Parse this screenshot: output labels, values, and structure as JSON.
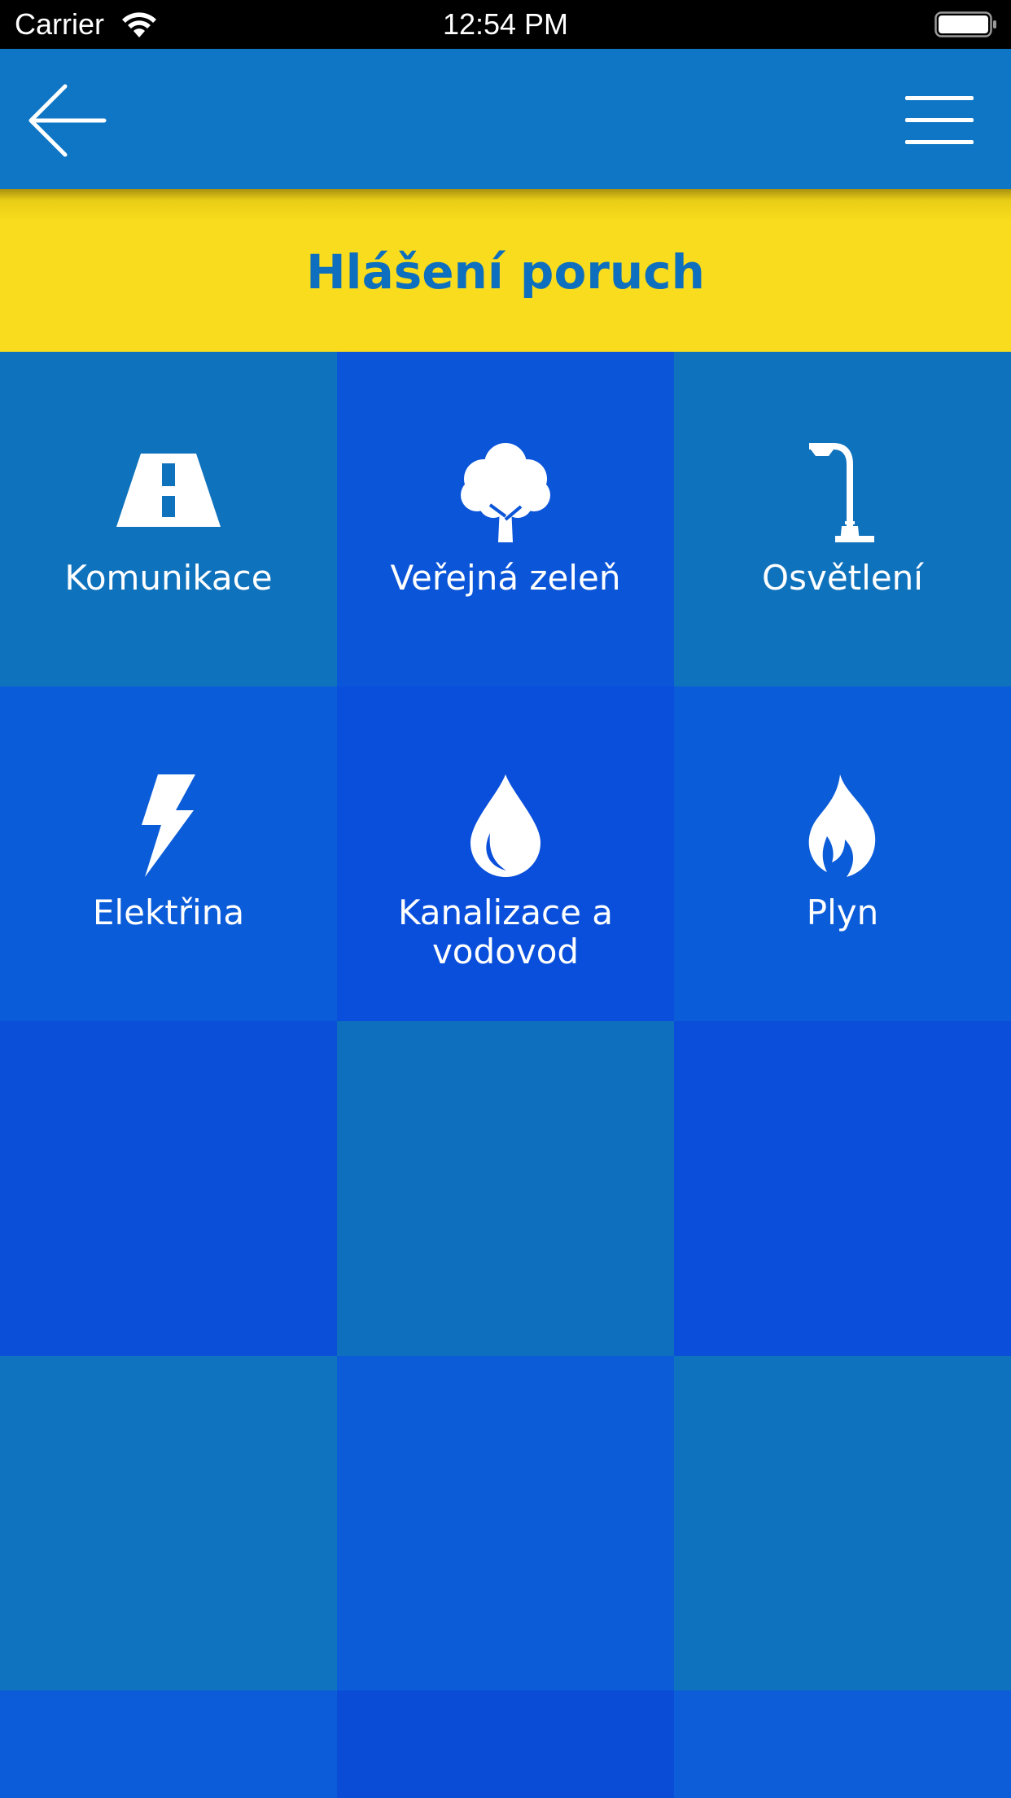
{
  "status_bar": {
    "carrier": "Carrier",
    "time": "12:54 PM"
  },
  "header": {
    "title": "Hlášení poruch"
  },
  "categories": [
    {
      "label": "Komunikace",
      "icon": "road-icon"
    },
    {
      "label": "Veřejná zeleň",
      "icon": "tree-icon"
    },
    {
      "label": "Osvětlení",
      "icon": "street-lamp-icon"
    },
    {
      "label": "Elektřina",
      "icon": "lightning-bolt-icon"
    },
    {
      "label_line1": "Kanalizace a",
      "label_line2": "vodovod",
      "icon": "water-drop-icon"
    },
    {
      "label": "Plyn",
      "icon": "flame-icon"
    }
  ],
  "colors": {
    "nav_bar": "#0e76c4",
    "title_banner": "#f8dc1d",
    "title_text": "#0e6fbe",
    "tile_dark_blue": "#0b54d8",
    "tile_steel_blue": "#0f74be"
  }
}
